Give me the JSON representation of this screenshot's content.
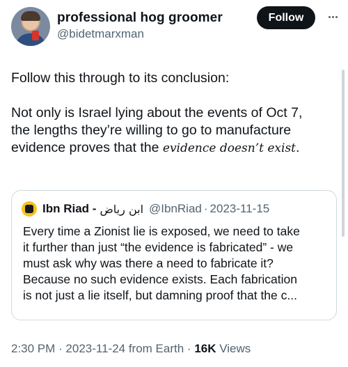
{
  "author": {
    "display_name": "professional hog groomer",
    "handle": "@bidetmarxman",
    "avatar": "avatar-photo"
  },
  "actions": {
    "follow_label": "Follow",
    "more_icon": "more-horizontal-icon"
  },
  "tweet": {
    "lines": [
      "Follow this through to its conclusion:",
      "",
      "Not only is Israel lying about the events of Oct 7,",
      "the lengths they’re willing to go to manufacture"
    ],
    "last_line_prefix": "evidence proves that the ",
    "last_line_italic": "evidence doesn’t exist",
    "last_line_suffix": "."
  },
  "quote": {
    "avatar": "raised-fist-avatar",
    "name": "Ibn Riad -",
    "arabic_name": "ابن رياض",
    "handle": "@IbnRiad",
    "separator": "·",
    "date": "2023-11-15",
    "lines": [
      "Every time a Zionist lie is exposed, we need to take",
      "it further than just “the evidence is fabricated” - we",
      "must ask why was there a need to fabricate it?",
      "Because no such evidence exists. Each fabrication",
      "is not just a lie itself, but damning proof that the c..."
    ]
  },
  "meta": {
    "timestamp": "2:30 PM · 2023-11-24 from Earth · ",
    "views_count": "16K",
    "views_label": " Views"
  }
}
